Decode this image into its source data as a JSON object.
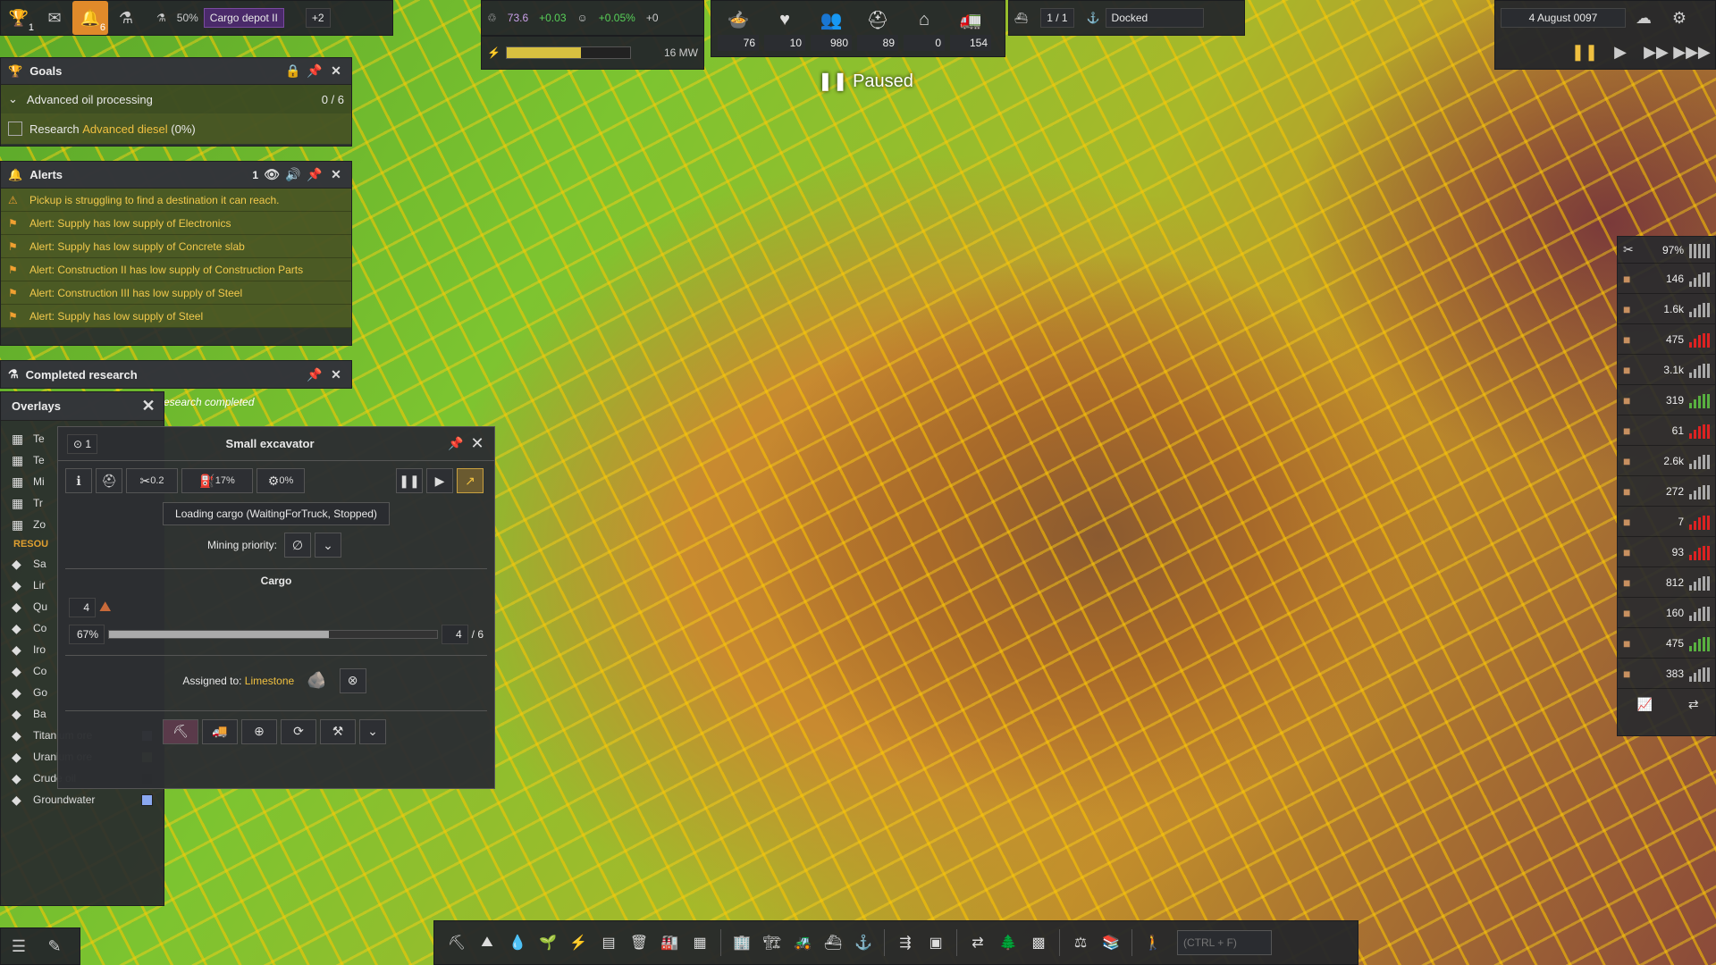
{
  "topbar": {
    "trophy_count": "1",
    "alerts_count": "6",
    "research_percent": "50%",
    "research_name": "Cargo depot II",
    "research_extra": "+2",
    "unity_value": "73.6",
    "unity_delta": "+0.03",
    "pop_growth": "+0.05%",
    "pop_extra": "+0",
    "power_value": "16 MW",
    "power_fill": 0.6,
    "ships": "1 / 1",
    "ship_status": "Docked",
    "date": "4 August 0097"
  },
  "pop_stats": [
    {
      "icon": "food-icon",
      "value": "76"
    },
    {
      "icon": "health-icon",
      "value": "10"
    },
    {
      "icon": "population-icon",
      "value": "980"
    },
    {
      "icon": "workers-icon",
      "value": "89"
    },
    {
      "icon": "housing-icon",
      "value": "0"
    },
    {
      "icon": "vehicles-icon",
      "value": "154"
    }
  ],
  "paused_label": "Paused",
  "goals": {
    "title": "Goals",
    "goal_name": "Advanced oil processing",
    "goal_progress": "0 / 6",
    "task_prefix": "Research",
    "task_link": "Advanced diesel",
    "task_percent": "(0%)"
  },
  "alerts": {
    "title": "Alerts",
    "count": "1",
    "items": [
      "Pickup is struggling to find a destination it can reach.",
      "Alert: Supply has low supply of Electronics",
      "Alert: Supply has low supply of Concrete slab",
      "Alert: Construction II has low supply of Construction Parts",
      "Alert: Construction III has low supply of Steel",
      "Alert: Supply has low supply of Steel"
    ]
  },
  "completed_research": {
    "title": "Completed research",
    "note": "esearch completed"
  },
  "overlays": {
    "title": "Overlays",
    "partial_items": [
      "Te",
      "Te",
      "Mi",
      "Tr",
      "Zo"
    ],
    "section": "RESOU",
    "resource_partial": [
      "Sa",
      "Lir",
      "Qu",
      "Co",
      "Iro",
      "Co",
      "Go",
      "Ba"
    ],
    "resources": [
      {
        "label": "Titanium ore",
        "color": "#a8aac8"
      },
      {
        "label": "Uranium ore",
        "color": "#98c060"
      },
      {
        "label": "Crude oil",
        "color": "#111111"
      },
      {
        "label": "Groundwater",
        "color": "#8aa8f0"
      }
    ]
  },
  "excavator": {
    "title": "Small excavator",
    "marker_count": "1",
    "stat_speed": "0.2",
    "stat_fuel": "17%",
    "stat_maint": "0%",
    "status": "Loading cargo (WaitingForTruck, Stopped)",
    "mining_priority_label": "Mining priority:",
    "cargo_title": "Cargo",
    "cargo_qty": "4",
    "cargo_percent": "67%",
    "cargo_fill": 0.67,
    "cargo_amount": "4",
    "cargo_capacity": "/ 6",
    "assigned_label": "Assigned to:",
    "assigned_value": "Limestone"
  },
  "right_panel": {
    "top_value": "97%",
    "items": [
      {
        "icon": "wood-icon",
        "value": "146",
        "color": "#aaaaaa"
      },
      {
        "icon": "rock-icon",
        "value": "1.6k",
        "color": "#aaaaaa"
      },
      {
        "icon": "iron-icon",
        "value": "475",
        "color": "#dd2222"
      },
      {
        "icon": "copper-icon",
        "value": "3.1k",
        "color": "#aaaaaa"
      },
      {
        "icon": "worker-icon",
        "value": "319",
        "color": "#58b040"
      },
      {
        "icon": "brick-icon",
        "value": "61",
        "color": "#dd2222"
      },
      {
        "icon": "fuel-icon",
        "value": "2.6k",
        "color": "#aaaaaa"
      },
      {
        "icon": "steel-icon",
        "value": "272",
        "color": "#aaaaaa"
      },
      {
        "icon": "tool-icon",
        "value": "7",
        "color": "#dd2222"
      },
      {
        "icon": "slab-icon",
        "value": "93",
        "color": "#dd2222"
      },
      {
        "icon": "parts-icon",
        "value": "812",
        "color": "#aaaaaa"
      },
      {
        "icon": "box-icon",
        "value": "160",
        "color": "#aaaaaa"
      },
      {
        "icon": "plate-icon",
        "value": "475",
        "color": "#58b040"
      },
      {
        "icon": "unit-icon",
        "value": "383",
        "color": "#aaaaaa"
      }
    ]
  },
  "search": {
    "placeholder": "(CTRL + F)"
  }
}
